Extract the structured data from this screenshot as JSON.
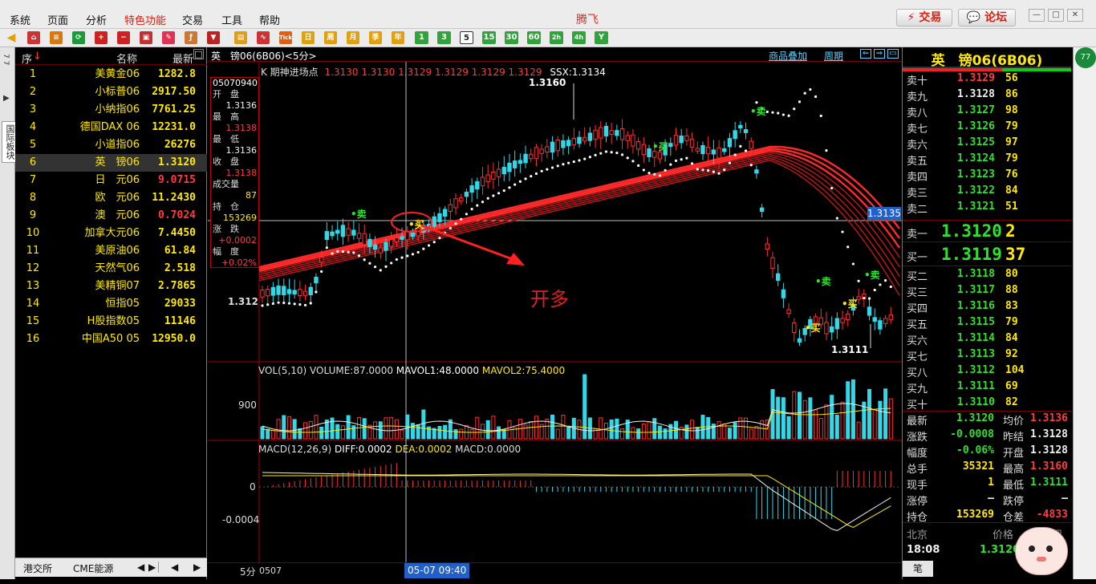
{
  "app": {
    "title": "腾飞",
    "menu": [
      "系统",
      "页面",
      "分析",
      "特色功能",
      "交易",
      "工具",
      "帮助"
    ],
    "trade_btn": "⚡ 交易",
    "forum_btn": "💬 论坛"
  },
  "toolbar": {
    "periods": [
      "1",
      "3",
      "5",
      "15",
      "30",
      "60",
      "2h",
      "4h",
      "Y"
    ],
    "active_period": "5",
    "tools": [
      "日",
      "周",
      "月",
      "季",
      "年"
    ]
  },
  "sidetab": {
    "label": "国际板块",
    "num": "7 7"
  },
  "watchlist": {
    "headers": [
      "序",
      "名称",
      "最新"
    ],
    "rows": [
      {
        "n": "1",
        "name": "美黄金06",
        "value": "1282.8",
        "color": "#ffea00"
      },
      {
        "n": "2",
        "name": "小标普06",
        "value": "2917.50",
        "color": "#ffea00"
      },
      {
        "n": "3",
        "name": "小纳指06",
        "value": "7761.25",
        "color": "#ffea00"
      },
      {
        "n": "4",
        "name": "德国DAX 06",
        "value": "12231.0",
        "color": "#ffea00"
      },
      {
        "n": "5",
        "name": "小道指06",
        "value": "26276",
        "color": "#ffea00"
      },
      {
        "n": "6",
        "name": "英　镑06",
        "value": "1.3120",
        "color": "#ffea00"
      },
      {
        "n": "7",
        "name": "日　元06",
        "value": "9.0715",
        "color": "#ff3c3c"
      },
      {
        "n": "8",
        "name": "欧　元06",
        "value": "11.2430",
        "color": "#ffea00"
      },
      {
        "n": "9",
        "name": "澳　元06",
        "value": "0.7024",
        "color": "#ff3c3c"
      },
      {
        "n": "10",
        "name": "加拿大元06",
        "value": "7.4450",
        "color": "#ffea00"
      },
      {
        "n": "11",
        "name": "美原油06",
        "value": "61.84",
        "color": "#ffea00"
      },
      {
        "n": "12",
        "name": "天然气06",
        "value": "2.518",
        "color": "#ffea00"
      },
      {
        "n": "13",
        "name": "美精铜07",
        "value": "2.7865",
        "color": "#ffea00"
      },
      {
        "n": "14",
        "name": "恒指05",
        "value": "29033",
        "color": "#ffea00"
      },
      {
        "n": "15",
        "name": "H股指数05",
        "value": "11146",
        "color": "#ffea00"
      },
      {
        "n": "16",
        "name": "中国A50 05",
        "value": "12950.0",
        "color": "#ffea00"
      }
    ],
    "selected_index": 5,
    "tabs": [
      "港交所",
      "CME能源"
    ]
  },
  "chart": {
    "header_left": "英　镑06(6B06)<5分>",
    "header_right": [
      "商品叠加",
      "周期"
    ],
    "info_label": "K  期神进场点",
    "info_values": "1.3130  1.3130  1.3129  1.3129  1.3129  1.3129",
    "ssx": "SSX:1.3134",
    "databox": {
      "time": "05070940",
      "open_label": "开　盘",
      "open": "1.3136",
      "high_label": "最　高",
      "high": "1.3138",
      "low_label": "最　低",
      "low": "1.3136",
      "close_label": "收　盘",
      "close": "1.3138",
      "vol_label": "成交量",
      "vol": "87",
      "oi_label": "持　仓",
      "oi": "153269",
      "chg_label": "涨　跌",
      "chg": "+0.0002",
      "pct_label": "幅　度",
      "pct": "+0.02%"
    },
    "price_high_label": "1.3160",
    "price_low_label": "1.3111",
    "axis_price": "1.312",
    "cur_price_tag": "1.3135",
    "annotation": "开多",
    "signals": {
      "buy": "买",
      "sell": "卖"
    },
    "vol_header": {
      "name": "VOL(5,10)",
      "volume": "VOLUME:87.0000",
      "mavol1": "MAVOL1:48.0000",
      "mavol2": "MAVOL2:75.4000"
    },
    "vol_axis": "900",
    "macd_header": {
      "name": "MACD(12,26,9)",
      "diff": "DIFF:0.0002",
      "dea": "DEA:0.0002",
      "macd": "MACD:0.0000"
    },
    "macd_axis": [
      "0",
      "-0.0004"
    ],
    "bottom": {
      "period": "5分",
      "start": "0507",
      "cursor_time": "05-07 09:40"
    }
  },
  "quote": {
    "title": "英　镑06(6B06)",
    "asks": [
      {
        "label": "卖十",
        "price": "1.3129",
        "vol": "56",
        "color": "#ff3c3c"
      },
      {
        "label": "卖九",
        "price": "1.3128",
        "vol": "86",
        "color": "#eeeeee"
      },
      {
        "label": "卖八",
        "price": "1.3127",
        "vol": "98",
        "color": "#30e030"
      },
      {
        "label": "卖七",
        "price": "1.3126",
        "vol": "79",
        "color": "#30e030"
      },
      {
        "label": "卖六",
        "price": "1.3125",
        "vol": "97",
        "color": "#30e030"
      },
      {
        "label": "卖五",
        "price": "1.3124",
        "vol": "79",
        "color": "#30e030"
      },
      {
        "label": "卖四",
        "price": "1.3123",
        "vol": "76",
        "color": "#30e030"
      },
      {
        "label": "卖三",
        "price": "1.3122",
        "vol": "84",
        "color": "#30e030"
      },
      {
        "label": "卖二",
        "price": "1.3121",
        "vol": "51",
        "color": "#30e030"
      }
    ],
    "ask1": {
      "label": "卖一",
      "price": "1.3120",
      "vol": "2"
    },
    "bid1": {
      "label": "买一",
      "price": "1.3119",
      "vol": "37"
    },
    "bids": [
      {
        "label": "买二",
        "price": "1.3118",
        "vol": "80"
      },
      {
        "label": "买三",
        "price": "1.3117",
        "vol": "88"
      },
      {
        "label": "买四",
        "price": "1.3116",
        "vol": "83"
      },
      {
        "label": "买五",
        "price": "1.3115",
        "vol": "79"
      },
      {
        "label": "买六",
        "price": "1.3114",
        "vol": "84"
      },
      {
        "label": "买七",
        "price": "1.3113",
        "vol": "92"
      },
      {
        "label": "买八",
        "price": "1.3112",
        "vol": "104"
      },
      {
        "label": "买九",
        "price": "1.3111",
        "vol": "69"
      },
      {
        "label": "买十",
        "price": "1.3110",
        "vol": "82"
      }
    ],
    "stats": [
      {
        "l": "最新",
        "v": "1.3120",
        "c": "#30e030",
        "l2": "均价",
        "v2": "1.3136",
        "c2": "#ff3c3c"
      },
      {
        "l": "涨跌",
        "v": "-0.0008",
        "c": "#30e030",
        "l2": "昨结",
        "v2": "1.3128",
        "c2": "#eeeeee"
      },
      {
        "l": "幅度",
        "v": "-0.06%",
        "c": "#30e030",
        "l2": "开盘",
        "v2": "1.3128",
        "c2": "#eeeeee"
      },
      {
        "l": "总手",
        "v": "35321",
        "c": "#ffea00",
        "l2": "最高",
        "v2": "1.3160",
        "c2": "#ff3c3c"
      },
      {
        "l": "现手",
        "v": "1",
        "c": "#ffea00",
        "l2": "最低",
        "v2": "1.3111",
        "c2": "#30e030"
      },
      {
        "l": "涨停",
        "v": "—",
        "c": "#eeeeee",
        "l2": "跌停",
        "v2": "—",
        "c2": "#eeeeee"
      },
      {
        "l": "持仓",
        "v": "153269",
        "c": "#ffea00",
        "l2": "仓差",
        "v2": "-4833",
        "c2": "#ff3c3c"
      }
    ],
    "tick_head": [
      "北京",
      "价格",
      "现"
    ],
    "tick_row": {
      "time": "18:08",
      "price": "1.3120"
    },
    "tab": "笔"
  }
}
